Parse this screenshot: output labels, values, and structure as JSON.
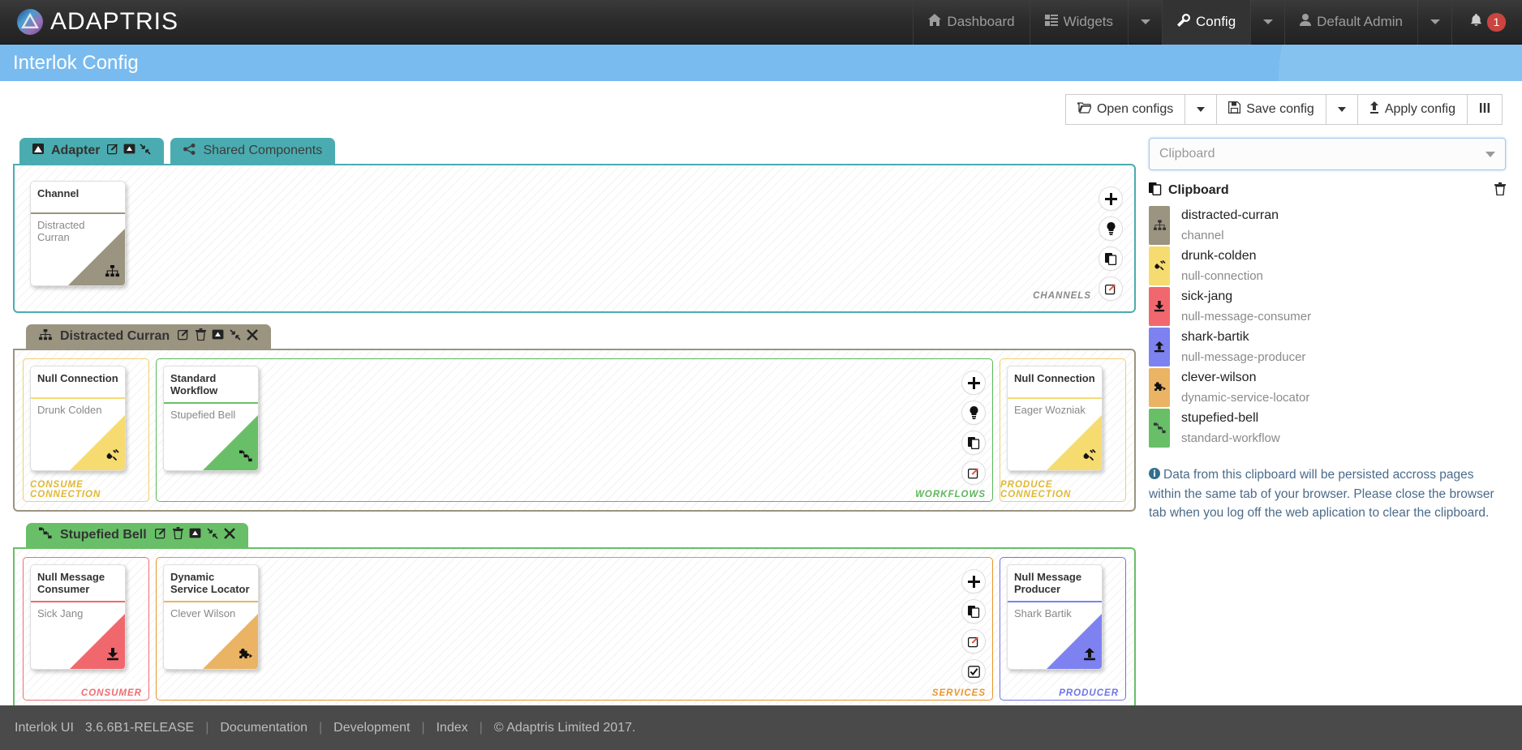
{
  "navbar": {
    "brand": "ADAPTRIS",
    "items": [
      {
        "label": "Dashboard",
        "icon": "home-icon",
        "active": false
      },
      {
        "label": "Widgets",
        "icon": "widgets-icon",
        "active": false
      },
      {
        "label": "Config",
        "icon": "wrench-icon",
        "active": true
      },
      {
        "label": "Default Admin",
        "icon": "user-icon",
        "active": false
      }
    ],
    "notification_count": "1"
  },
  "page": {
    "title": "Interlok Config"
  },
  "toolbar": {
    "open_configs": "Open configs",
    "save_config": "Save config",
    "apply_config": "Apply config",
    "columns_icon": "columns-icon"
  },
  "adapter_panel": {
    "tabs": [
      {
        "label": "Adapter",
        "icon": "adapter-icon",
        "active": true
      },
      {
        "label": "Shared Components",
        "icon": "share-icon",
        "active": false
      }
    ],
    "tab_actions": [
      "edit-icon",
      "screen-icon",
      "collapse-icon"
    ],
    "slot_label": "CHANNELS",
    "accent": "#4aacb0",
    "cards": [
      {
        "title": "Channel",
        "subtitle": "Distracted Curran",
        "color": "#9a9480",
        "glyph": "sitemap-icon"
      }
    ],
    "side_buttons": [
      "plus-icon",
      "bulb-icon",
      "paste-icon",
      "edit-icon"
    ]
  },
  "channel_panel": {
    "title": "Distracted Curran",
    "icon": "sitemap-icon",
    "accent": "#9a9480",
    "header_actions": [
      "edit-icon",
      "trash-icon",
      "screen-icon",
      "collapse-icon",
      "close-icon"
    ],
    "consume": {
      "label": "CONSUME CONNECTION",
      "border": "#f0cf6b",
      "card": {
        "title": "Null Connection",
        "subtitle": "Drunk Colden",
        "color": "#f6db70",
        "glyph": "plug-icon"
      }
    },
    "workflows": {
      "label": "WORKFLOWS",
      "border": "#5cb85c",
      "card": {
        "title": "Standard Workflow",
        "subtitle": "Stupefied Bell",
        "color": "#68bf68",
        "glyph": "workflow-icon"
      },
      "side_buttons": [
        "plus-icon",
        "bulb-icon",
        "paste-icon",
        "edit-icon"
      ]
    },
    "produce": {
      "label": "PRODUCE CONNECTION",
      "border": "#f0cf6b",
      "card": {
        "title": "Null Connection",
        "subtitle": "Eager Wozniak",
        "color": "#f6db70",
        "glyph": "plug-icon"
      }
    }
  },
  "workflow_panel": {
    "title": "Stupefied Bell",
    "icon": "workflow-icon",
    "accent": "#68bf68",
    "header_actions": [
      "edit-icon",
      "trash-icon",
      "screen-icon",
      "collapse-icon",
      "close-icon"
    ],
    "consumer": {
      "label": "CONSUMER",
      "border": "#ee6f72",
      "card": {
        "title": "Null Message Consumer",
        "subtitle": "Sick Jang",
        "color": "#f0686d",
        "glyph": "download-icon"
      }
    },
    "services": {
      "label": "SERVICES",
      "border": "#e8962e",
      "card": {
        "title": "Dynamic Service Locator",
        "subtitle": "Clever Wilson",
        "color": "#eab464",
        "glyph": "puzzle-icon"
      },
      "side_buttons": [
        "plus-icon",
        "paste-icon",
        "edit-icon",
        "check-icon"
      ]
    },
    "producer": {
      "label": "PRODUCER",
      "border": "#6f74e8",
      "card": {
        "title": "Null Message Producer",
        "subtitle": "Shark Bartik",
        "color": "#7d82f0",
        "glyph": "upload-icon"
      }
    }
  },
  "clipboard": {
    "select_placeholder": "Clipboard",
    "header": "Clipboard",
    "header_icon": "clipboard-icon",
    "clear_icon": "trash-icon",
    "items": [
      {
        "name": "distracted-curran",
        "type": "channel",
        "color": "#9a9480",
        "glyph": "sitemap-icon"
      },
      {
        "name": "drunk-colden",
        "type": "null-connection",
        "color": "#f6db70",
        "glyph": "plug-icon"
      },
      {
        "name": "sick-jang",
        "type": "null-message-consumer",
        "color": "#f0686d",
        "glyph": "download-icon"
      },
      {
        "name": "shark-bartik",
        "type": "null-message-producer",
        "color": "#7d82f0",
        "glyph": "upload-icon"
      },
      {
        "name": "clever-wilson",
        "type": "dynamic-service-locator",
        "color": "#eab464",
        "glyph": "puzzle-icon"
      },
      {
        "name": "stupefied-bell",
        "type": "standard-workflow",
        "color": "#68bf68",
        "glyph": "workflow-icon"
      }
    ],
    "note": "Data from this clipboard will be persisted accross pages within the same tab of your browser. Please close the browser tab when you log off the web aplication to clear the clipboard.",
    "note_icon": "info-icon"
  },
  "footer": {
    "product": "Interlok UI",
    "version": "3.6.6B1-RELEASE",
    "links": [
      "Documentation",
      "Development",
      "Index"
    ],
    "copyright": "© Adaptris Limited 2017."
  }
}
